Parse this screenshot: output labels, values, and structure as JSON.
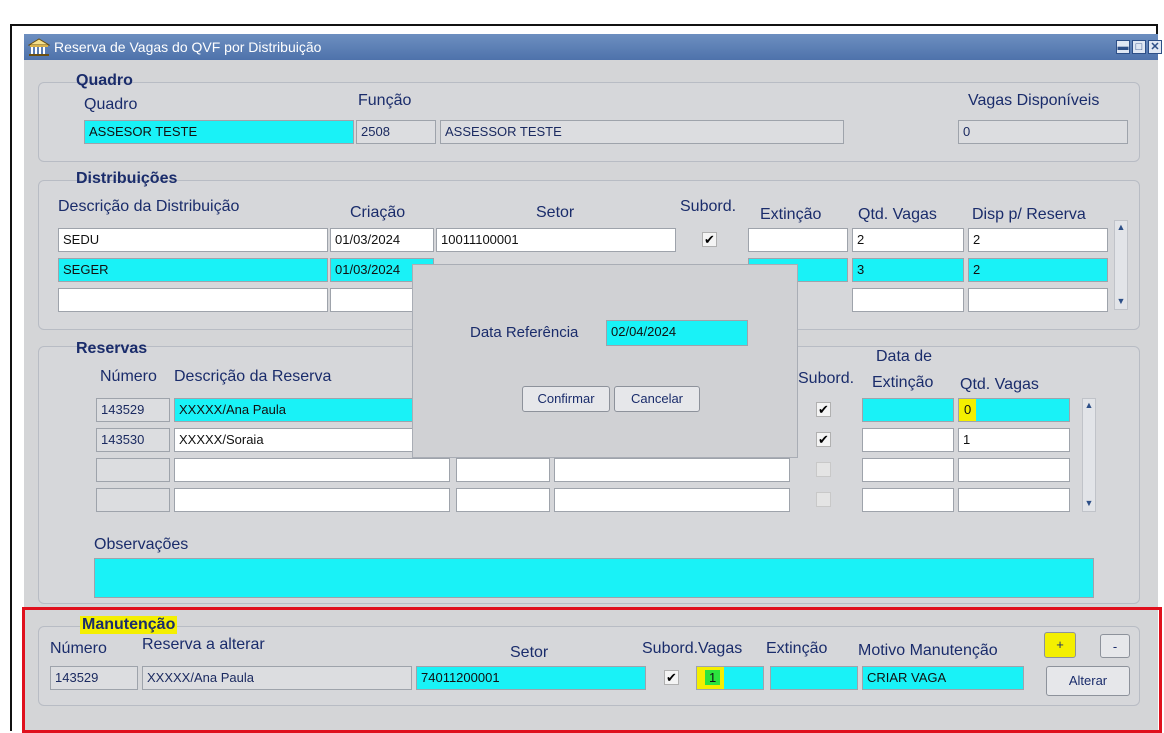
{
  "window": {
    "title": "Reserva de Vagas do QVF por Distribuição",
    "controls": [
      "minimize",
      "maximize",
      "close"
    ]
  },
  "quadro": {
    "section_title": "Quadro",
    "label_quadro": "Quadro",
    "label_funcao": "Função",
    "label_vagas": "Vagas Disponíveis",
    "quadro_value": "ASSESOR TESTE",
    "funcao_code": "2508",
    "funcao_desc": "ASSESSOR TESTE",
    "vagas_value": "0"
  },
  "distribuicoes": {
    "section_title": "Distribuições",
    "columns": {
      "descricao": "Descrição da Distribuição",
      "criacao": "Criação",
      "setor": "Setor",
      "subord": "Subord.",
      "extincao": "Extinção",
      "qtd_vagas": "Qtd. Vagas",
      "disp": "Disp p/ Reserva"
    },
    "rows": [
      {
        "descricao": "SEDU",
        "criacao": "01/03/2024",
        "setor": "10011100001",
        "subord": "✔",
        "extincao": "",
        "qtd": "2",
        "disp": "2"
      },
      {
        "descricao": "SEGER",
        "criacao": "01/03/2024",
        "setor": "",
        "subord": "",
        "extincao": "",
        "qtd": "3",
        "disp": "2"
      },
      {
        "descricao": "",
        "criacao": "",
        "setor": "",
        "subord": "",
        "extincao": "",
        "qtd": "",
        "disp": ""
      }
    ]
  },
  "reservas": {
    "section_title": "Reservas",
    "columns": {
      "numero": "Número",
      "descricao": "Descrição da Reserva",
      "subord": "Subord.",
      "data_extincao_1": "Data de",
      "data_extincao_2": "Extinção",
      "qtd_vagas": "Qtd. Vagas"
    },
    "rows": [
      {
        "numero": "143529",
        "descricao": "XXXXX/Ana Paula",
        "subord": "✔",
        "qtd": "0"
      },
      {
        "numero": "143530",
        "descricao": "XXXXX/Soraia",
        "subord": "✔",
        "qtd": "1"
      },
      {
        "numero": "",
        "descricao": "",
        "subord": "",
        "qtd": ""
      },
      {
        "numero": "",
        "descricao": "",
        "subord": "",
        "qtd": ""
      }
    ],
    "observacoes_label": "Observações",
    "observacoes_value": ""
  },
  "dialog": {
    "label": "Data Referência",
    "value": "02/04/2024",
    "confirm_label": "Confirmar",
    "cancel_label": "Cancelar"
  },
  "manutencao": {
    "section_title": "Manutenção",
    "label_numero": "Número",
    "label_reserva": "Reserva a alterar",
    "label_setor": "Setor",
    "label_subord_vagas": "Subord.Vagas",
    "label_extincao": "Extinção",
    "label_motivo": "Motivo Manutenção",
    "numero": "143529",
    "reserva": "XXXXX/Ana Paula",
    "setor": "74011200001",
    "subord": "✔",
    "vagas": "1",
    "extincao": "",
    "motivo": "CRIAR VAGA",
    "plus_label": "+",
    "minus_label": "-",
    "alterar_label": "Alterar"
  },
  "colors": {
    "field_active": "#19f2f7",
    "highlight_yellow": "#f4ef00",
    "highlight_green": "#2be33e",
    "annotation_red": "#e0101d",
    "title_bar": "#5a7db5"
  }
}
